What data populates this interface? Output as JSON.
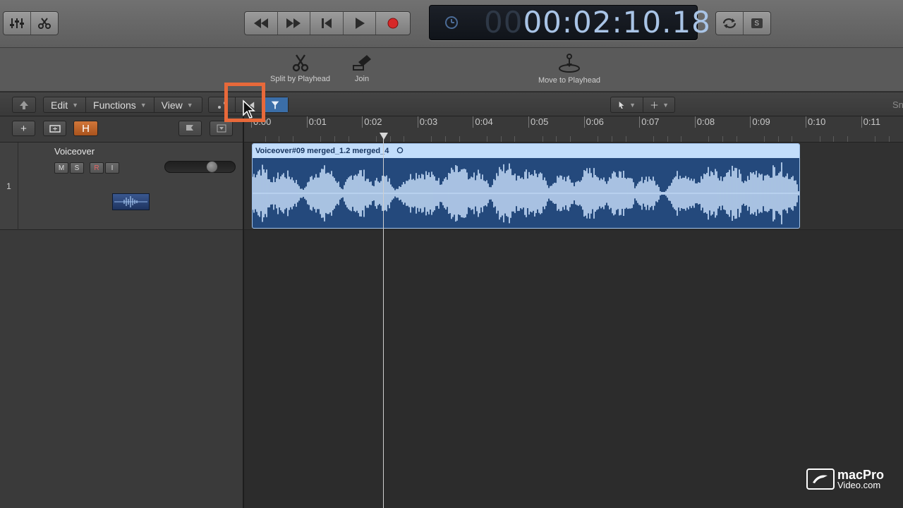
{
  "transport": {
    "time_dim": "00",
    "time_bright": "00:02:10.18",
    "solo_label": "S"
  },
  "toolbar": {
    "split_label": "Split by Playhead",
    "join_label": "Join",
    "move_label": "Move to Playhead"
  },
  "tracks_menu": {
    "edit": "Edit",
    "functions": "Functions",
    "view": "View"
  },
  "track_list_header": {
    "h_label": "H",
    "plus_label": "+"
  },
  "track": {
    "number": "1",
    "name": "Voiceover",
    "mute": "M",
    "solo": "S",
    "record": "R",
    "input": "I",
    "volume_level": 0.62
  },
  "ruler": {
    "labels": [
      "0:00",
      "0:01",
      "0:02",
      "0:03",
      "0:04",
      "0:05",
      "0:06",
      "0:07",
      "0:08",
      "0:09",
      "0:10",
      "0:11"
    ],
    "playhead_time": "0:02.18",
    "right_label": "Sn"
  },
  "region": {
    "name": "Voiceover#09 merged_1.2 merged_4",
    "loop_icon": "loop-circle-icon",
    "color": "#24497c",
    "header_color": "#c2ddfb"
  },
  "logo": {
    "line1": "macPro",
    "line2": "Video.com"
  },
  "colors": {
    "highlight": "#e8693a",
    "lcd_text": "#a9c4e6",
    "record_dot": "#d62828"
  }
}
